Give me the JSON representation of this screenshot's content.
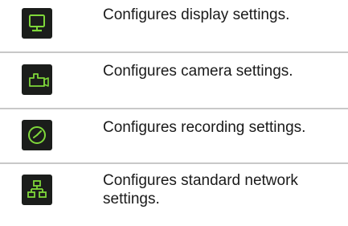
{
  "colors": {
    "icon_background": "#1b1d1b",
    "icon_stroke": "#7fd83a",
    "divider": "#c8c8c8",
    "text": "#1a1a1a"
  },
  "rows": [
    {
      "icon": "monitor-icon",
      "description": "Configures display settings."
    },
    {
      "icon": "camera-icon",
      "description": "Configures camera settings."
    },
    {
      "icon": "clock-icon",
      "description": "Configures recording settings."
    },
    {
      "icon": "network-icon",
      "description": "Configures standard network settings."
    }
  ]
}
